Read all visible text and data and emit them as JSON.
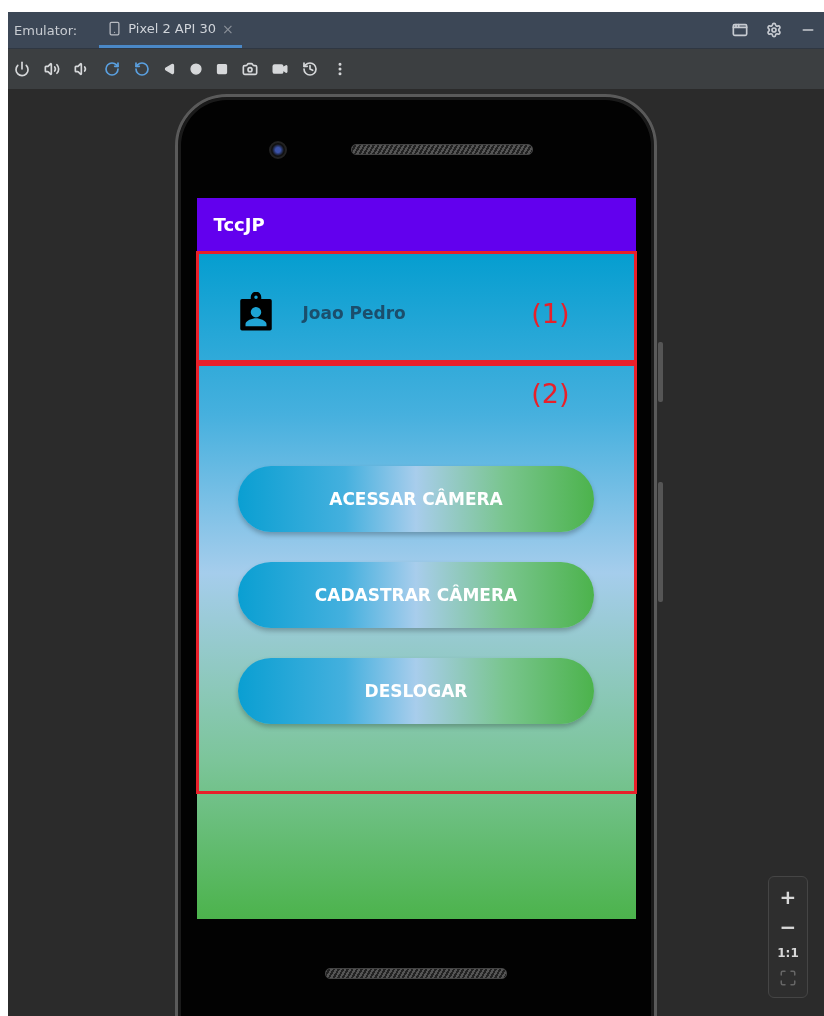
{
  "ide": {
    "label": "Emulator:",
    "tabs": [
      {
        "label": "Pixel 2 API 30",
        "close": "×",
        "selected": true
      }
    ]
  },
  "zoom_controls": [
    "+",
    "−",
    "1:1"
  ],
  "app": {
    "title": "TccJP",
    "profile": {
      "name": "Joao Pedro",
      "annotation": "(1)"
    },
    "actions": {
      "annotation": "(2)",
      "buttons": [
        "ACESSAR CÂMERA",
        "CADASTRAR CÂMERA",
        "DESLOGAR"
      ]
    }
  }
}
